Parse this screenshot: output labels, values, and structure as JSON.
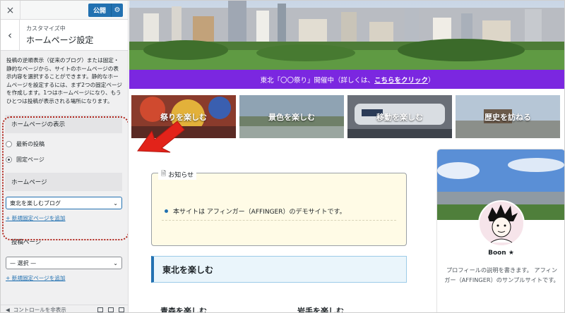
{
  "topbar": {
    "close_icon": "×",
    "publish_label": "公開",
    "gear_icon": "⚙"
  },
  "section": {
    "back_icon": "‹",
    "subtitle": "カスタマイズ中",
    "title": "ホームページ設定"
  },
  "description": "投稿の逆順表示（従来のブログ）または固定・静的なページから、サイトのホームページの表示内容を選択することができます。静的なホームページを設定するには、まず2つの固定ページを作成します。1つはホームページになり、もうひとつは投稿が表示される場所になります。",
  "homepage_display": {
    "label": "ホームページの表示",
    "options": [
      "最新の投稿",
      "固定ページ"
    ],
    "selected": "固定ページ"
  },
  "homepage": {
    "label": "ホームページ",
    "value": "東北を楽しむブログ",
    "add_link": "+ 新規固定ページを追加"
  },
  "posts_page": {
    "label": "投稿ページ",
    "value": "— 選択 —",
    "add_link": "+ 新規固定ページを追加"
  },
  "footer": {
    "label": "コントロールを非表示"
  },
  "banner": {
    "text": "東北「〇〇祭り」開催中（詳しくは、",
    "link": "こちらをクリック",
    "suffix": "）"
  },
  "categories": [
    {
      "label": "祭りを楽しむ"
    },
    {
      "label": "景色を楽しむ"
    },
    {
      "label": "移動を楽しむ"
    },
    {
      "label": "歴史を訪ねる"
    }
  ],
  "notice": {
    "title": "お知らせ",
    "item": "本サイトは アフィンガー（AFFINGER）のデモサイトです。"
  },
  "section_heading": "東北を楽しむ",
  "sub_headings": [
    "青森を楽しむ",
    "岩手を楽しむ"
  ],
  "profile": {
    "name": "Boon ★",
    "description": "プロフィールの説明を書きます。 アフィンガー（AFFINGER）のサンプルサイトです。"
  },
  "colors": {
    "accent": "#2271b1",
    "banner": "#7b27e0",
    "highlight": "#b0251c",
    "arrow": "#e2231a"
  }
}
